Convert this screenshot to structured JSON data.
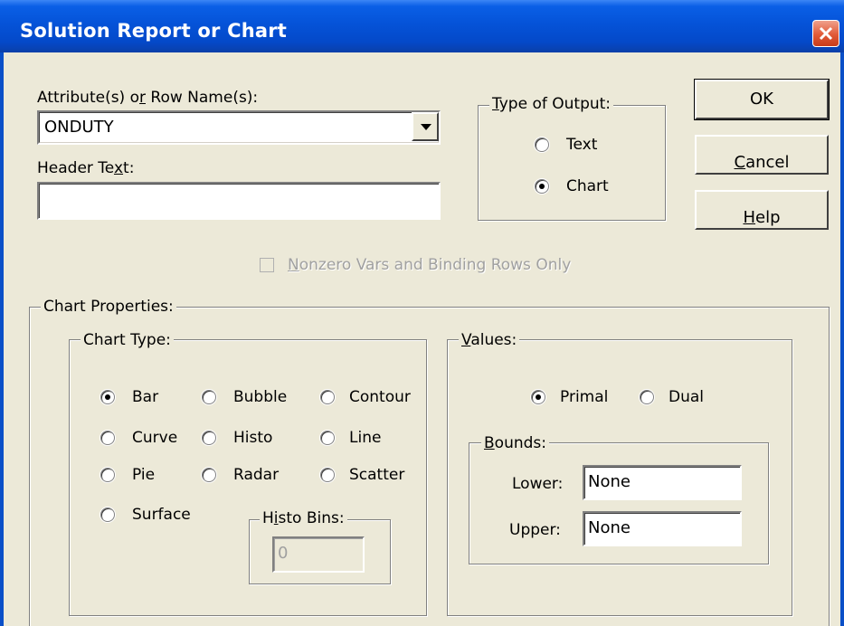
{
  "window": {
    "title": "Solution Report or Chart"
  },
  "attribute": {
    "label_pre": "Attribute(s) o",
    "label_u": "r",
    "label_post": " Row Name(s):",
    "value": "ONDUTY"
  },
  "header_text": {
    "label_pre": "Header Te",
    "label_u": "x",
    "label_post": "t:",
    "value": ""
  },
  "output_type": {
    "title_u": "T",
    "title_post": "ype of Output:",
    "options": [
      {
        "label": "Text",
        "checked": false
      },
      {
        "label": "Chart",
        "checked": true
      }
    ]
  },
  "buttons": {
    "ok": "OK",
    "cancel_u": "C",
    "cancel_post": "ancel",
    "help_u": "H",
    "help_post": "elp"
  },
  "nonzero": {
    "label_u": "N",
    "label_post": "onzero Vars and Binding Rows Only",
    "checked": false,
    "enabled": false
  },
  "chart_properties": {
    "title": "Chart Properties:"
  },
  "chart_type": {
    "title": "Chart Type:",
    "options": [
      {
        "label": "Bar",
        "checked": true
      },
      {
        "label": "Bubble",
        "checked": false
      },
      {
        "label": "Contour",
        "checked": false
      },
      {
        "label": "Curve",
        "checked": false
      },
      {
        "label": "Histo",
        "checked": false
      },
      {
        "label": "Line",
        "checked": false
      },
      {
        "label": "Pie",
        "checked": false
      },
      {
        "label": "Radar",
        "checked": false
      },
      {
        "label": "Scatter",
        "checked": false
      },
      {
        "label": "Surface",
        "checked": false
      }
    ],
    "histo_bins": {
      "title_pre": "H",
      "title_u": "i",
      "title_post": "sto Bins:",
      "value": "0",
      "enabled": false
    }
  },
  "values": {
    "title_u": "V",
    "title_post": "alues:",
    "options": [
      {
        "label": "Primal",
        "checked": true
      },
      {
        "label": "Dual",
        "checked": false
      }
    ],
    "bounds": {
      "title_u": "B",
      "title_post": "ounds:",
      "lower_label": "Lower:",
      "lower_value": "None",
      "upper_label": "Upper:",
      "upper_value": "None"
    }
  }
}
